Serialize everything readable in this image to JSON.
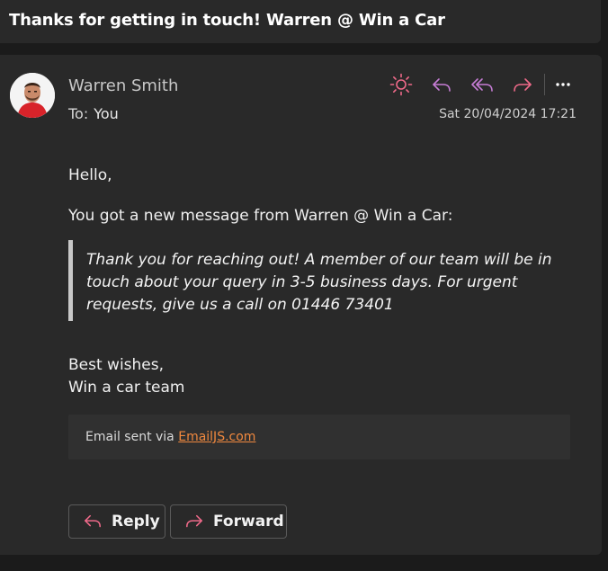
{
  "email": {
    "subject": "Thanks for getting in touch! Warren @ Win a Car",
    "sender_name": "Warren Smith",
    "to_label": "To:",
    "to_value": "You",
    "date": "Sat 20/04/2024 17:21"
  },
  "toolbar": {
    "icons": [
      "sun-icon",
      "reply-icon",
      "reply-all-icon",
      "forward-icon",
      "more-icon"
    ],
    "colors": {
      "sun": "#f06a8a",
      "reply": "#c77dd6",
      "reply_all": "#c77dd6",
      "forward": "#f06a8a",
      "more": "#ffffff"
    }
  },
  "body": {
    "greeting": "Hello,",
    "intro": "You got a new message from Warren @ Win a Car:",
    "quote": "Thank you for reaching out! A member of our team will be in touch about your query in 3-5 business days. For urgent requests, give us a call on 01446 73401",
    "signoff_line1": "Best wishes,",
    "signoff_line2": "Win a car team"
  },
  "footer": {
    "prefix": "Email sent via ",
    "link_text": "EmailJS.com",
    "link_color": "#f0883e"
  },
  "buttons": {
    "reply_label": "Reply",
    "forward_label": "Forward"
  }
}
